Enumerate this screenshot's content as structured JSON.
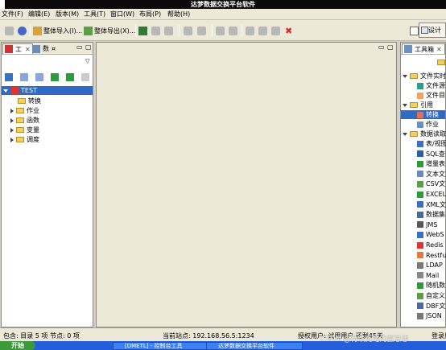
{
  "window": {
    "title": "达梦数据交换平台软件"
  },
  "menu": [
    "文件(F)",
    "编辑(E)",
    "版本(M)",
    "工具(T)",
    "窗口(W)",
    "布局(P)",
    "帮助(H)"
  ],
  "toolbar": {
    "import_all": "整体导入(I)...",
    "export_all": "整体导出(X)...",
    "design": "设计"
  },
  "left_panel": {
    "tabs": [
      "工",
      "数",
      "¤"
    ],
    "tree": {
      "root": "TEST",
      "children": [
        "转换",
        "作业",
        "函数",
        "变量",
        "调度"
      ]
    }
  },
  "toolbox": {
    "tab": "工具箱",
    "groups": [
      {
        "label": "文件实时",
        "items": [
          "文件源",
          "文件目"
        ]
      },
      {
        "label": "引用",
        "items": [
          "转换",
          "作业"
        ]
      },
      {
        "label": "数据读取",
        "items": [
          "表/视图",
          "SQL查",
          "增量表",
          "文本文",
          "CSV文",
          "EXCEL",
          "XML文",
          "数据集",
          "JMS",
          "WebS",
          "Redis",
          "Restfu",
          "LDAP",
          "Mail",
          "随机数",
          "自定义",
          "DBF文",
          "JSON"
        ]
      }
    ]
  },
  "status": {
    "left": "包含: 目录 5 项 节点: 0 项",
    "site": "当前站点: 192.168.56.5:1234",
    "user": "授权用户: 试用用户 还剩45天",
    "extra": "登录用"
  },
  "taskbar": {
    "start": "开始",
    "items": [
      "[DMETL] - 控制台工具",
      "达梦数据交换平台软件"
    ]
  },
  "watermark": "CSDN @待续充电的蜜思想"
}
